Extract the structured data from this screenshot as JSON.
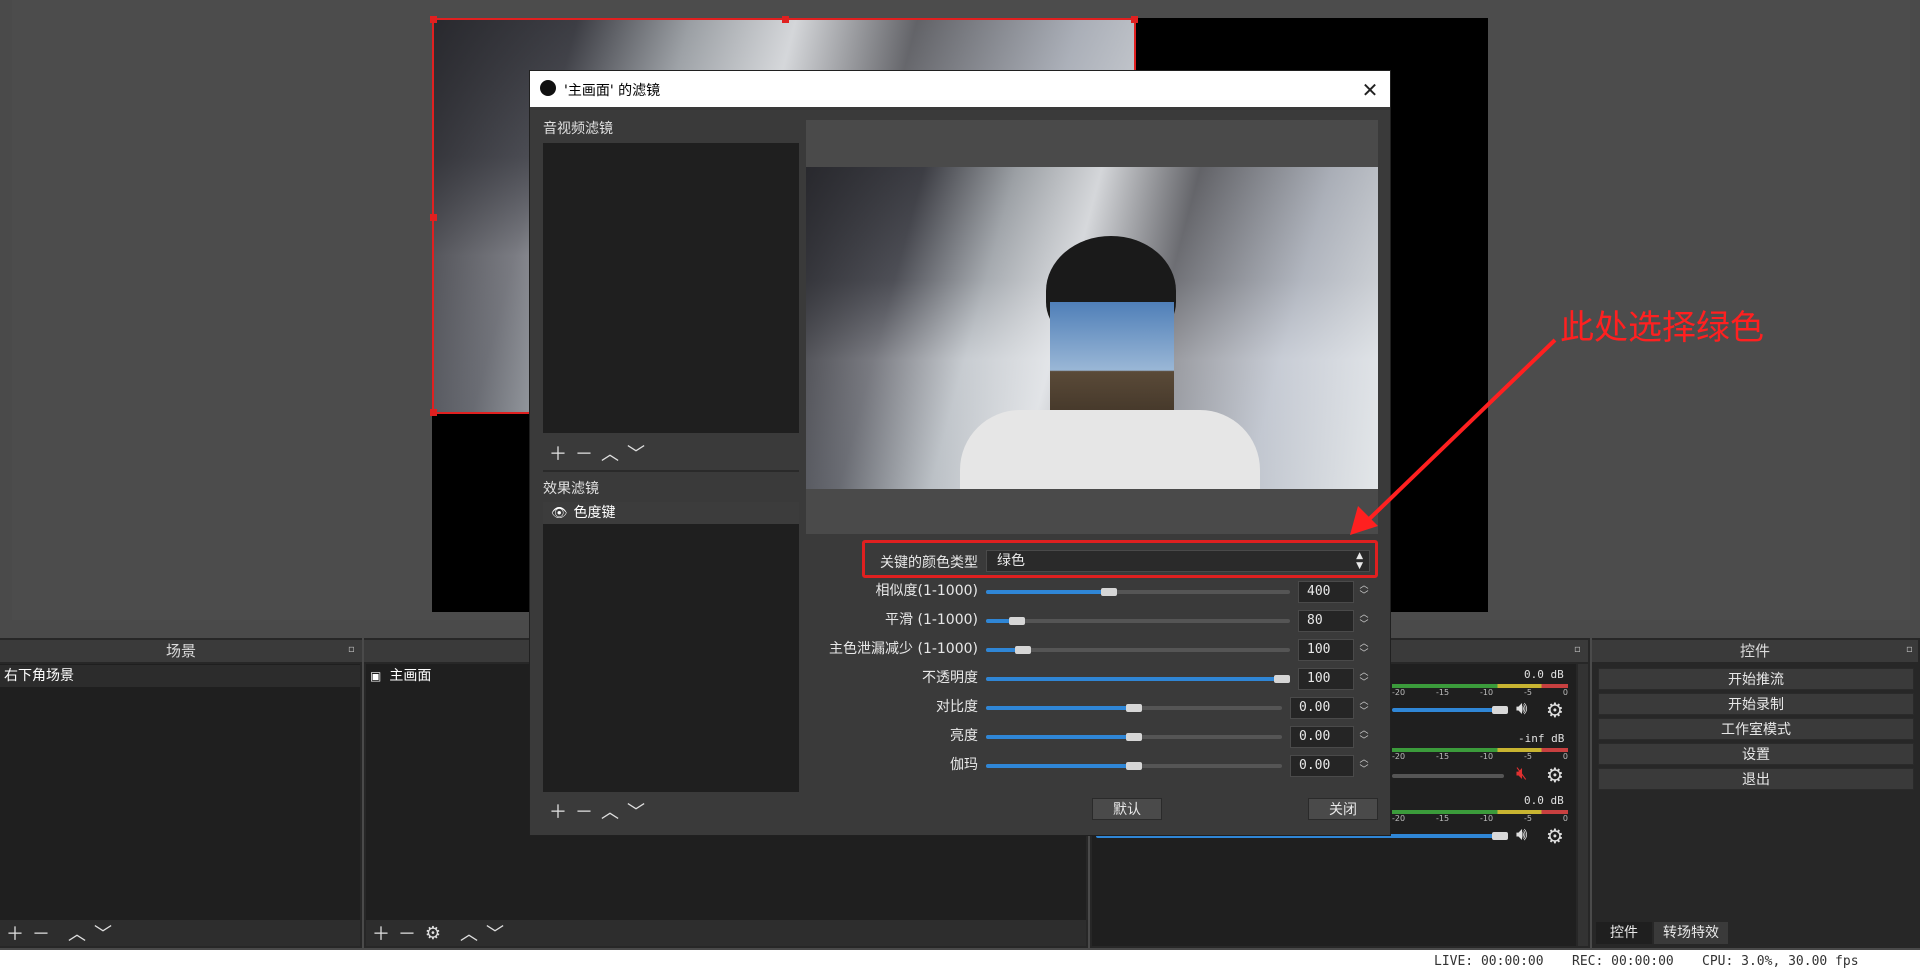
{
  "colors": {
    "accent": "#2f86d6",
    "annotation": "#ff2020",
    "selection": "#e02020"
  },
  "docks": {
    "scenes": {
      "title": "场景",
      "items": [
        "右下角场景"
      ]
    },
    "sources": {
      "items": [
        {
          "label": "主画面",
          "icon": "camera-icon"
        }
      ]
    },
    "controls": {
      "title": "控件",
      "buttons": [
        "开始推流",
        "开始录制",
        "工作室模式",
        "设置",
        "退出"
      ],
      "tabs": [
        "控件",
        "转场特效"
      ]
    },
    "mixer": {
      "channels": [
        {
          "db": "0.0 dB",
          "muted": false,
          "volume": 0.98
        },
        {
          "db": "-inf dB",
          "muted": true,
          "volume": 0.95
        },
        {
          "db": "0.0 dB",
          "muted": false,
          "volume": 0.98
        }
      ],
      "ticks": [
        "-20",
        "-15",
        "-10",
        "-5",
        "0"
      ]
    }
  },
  "dialog": {
    "title": "'主画面' 的滤镜",
    "av_filters_label": "音视频滤镜",
    "effect_filters_label": "效果滤镜",
    "effect_filters": [
      {
        "name": "色度键",
        "visible": true
      }
    ],
    "key_color_label": "关键的颜色类型",
    "key_color_value": "绿色",
    "settings": [
      {
        "label": "相似度(1-1000)",
        "value": "400",
        "fraction": 0.4
      },
      {
        "label": "平滑 (1-1000)",
        "value": "80",
        "fraction": 0.08
      },
      {
        "label": "主色泄漏减少 (1-1000)",
        "value": "100",
        "fraction": 0.1
      },
      {
        "label": "不透明度",
        "value": "100",
        "fraction": 1.0
      },
      {
        "label": "对比度",
        "value": "0.00",
        "fraction": 0.5
      },
      {
        "label": "亮度",
        "value": "0.00",
        "fraction": 0.5
      },
      {
        "label": "伽玛",
        "value": "0.00",
        "fraction": 0.5
      }
    ],
    "default_button": "默认",
    "close_button": "关闭"
  },
  "annotation": {
    "text": "此处选择绿色"
  },
  "status": {
    "live": "LIVE: 00:00:00",
    "rec": "REC: 00:00:00",
    "cpu": "CPU: 3.0%, 30.00 fps"
  }
}
